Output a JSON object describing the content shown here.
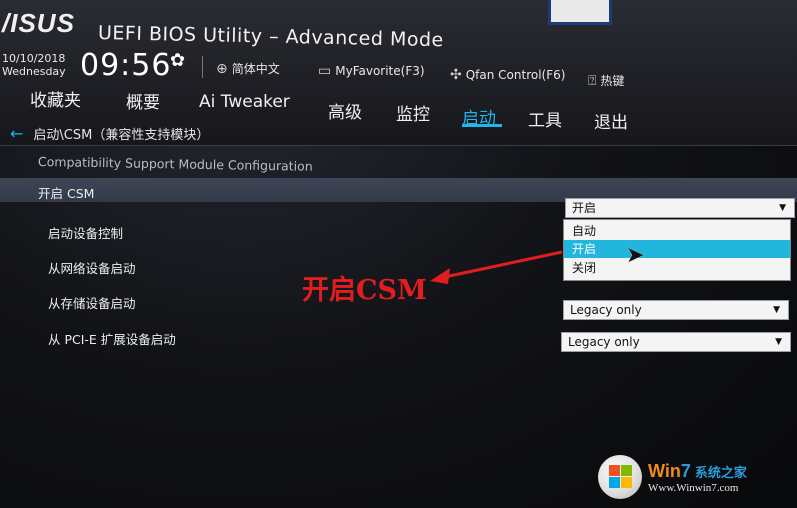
{
  "header": {
    "logo": "/ISUS",
    "title": "UEFI BIOS Utility – Advanced Mode",
    "date": "10/10/2018",
    "weekday": "Wednesday",
    "time": "09:56",
    "toolbar": [
      {
        "icon": "globe-icon",
        "label": "简体中文"
      },
      {
        "icon": "favorite-icon",
        "label": "MyFavorite(F3)"
      },
      {
        "icon": "fan-icon",
        "label": "Qfan Control(F6)"
      },
      {
        "icon": "help-icon",
        "label": "热键"
      }
    ]
  },
  "nav": {
    "items": [
      "收藏夹",
      "概要",
      "Ai Tweaker",
      "高级",
      "监控",
      "启动",
      "工具",
      "退出"
    ],
    "active": "启动"
  },
  "breadcrumb": "启动\\CSM（兼容性支持模块）",
  "subtitle": "Compatibility Support Module Configuration",
  "settings": [
    {
      "label": "开启 CSM",
      "value": "开启"
    },
    {
      "label": "启动设备控制"
    },
    {
      "label": "从网络设备启动"
    },
    {
      "label": "从存储设备启动",
      "value": "Legacy only"
    },
    {
      "label": "从 PCI-E 扩展设备启动",
      "value": "Legacy only"
    }
  ],
  "dropdown_menu": {
    "options": [
      "自动",
      "开启",
      "关闭"
    ],
    "selected": "开启"
  },
  "annotation": {
    "text": "开启CSM",
    "color": "#e21d1d"
  },
  "watermark": {
    "brand_prefix": "Win",
    "brand_number": "7",
    "brand_cn": "系统之家",
    "url": "Www.Winwin7.com"
  },
  "colors": {
    "accent": "#1fb6ea",
    "highlight_row": "#3a4152"
  }
}
